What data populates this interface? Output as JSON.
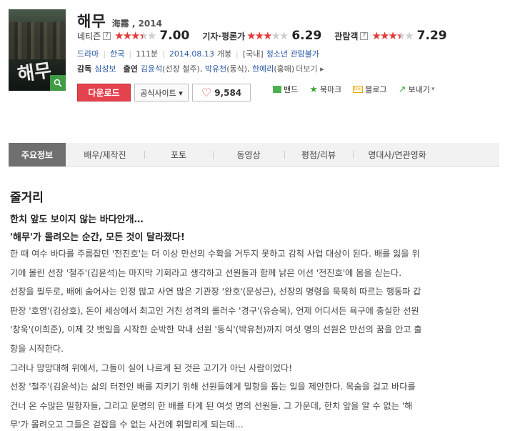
{
  "movie": {
    "title": "해무",
    "subtitle": "海霧 , 2014"
  },
  "ratings": [
    {
      "label": "네티즌",
      "has_help": true,
      "stars_filled": 3.5,
      "score": "7.00"
    },
    {
      "label": "기자·평론가",
      "has_help": false,
      "stars_filled": 3,
      "score": "6.29"
    },
    {
      "label": "관람객",
      "has_help": true,
      "stars_filled": 3.5,
      "score": "7.29"
    }
  ],
  "info": {
    "genre": "드라마",
    "country": "한국",
    "runtime": "111분",
    "release_date": "2014.08.13",
    "release_suffix": "개봉",
    "rating_region": "[국내]",
    "rating": "청소년 관람불가"
  },
  "credits": {
    "director_label": "감독",
    "director": "심성보",
    "cast_label": "출연",
    "cast": [
      {
        "name": "김윤석",
        "role": "(선장 철주)"
      },
      {
        "name": "박유천",
        "role": "(동식)"
      },
      {
        "name": "한예리",
        "role": "(홍매)"
      }
    ],
    "more": "더보기 ▸"
  },
  "actions": {
    "download": "다운로드",
    "official_site": "공식사이트 ▾",
    "like_count": "9,584"
  },
  "shares": [
    {
      "label": "밴드",
      "icon": "band-icon"
    },
    {
      "label": "북마크",
      "icon": "bookmark-star-icon"
    },
    {
      "label": "블로그",
      "icon": "blog-icon"
    },
    {
      "label": "보내기",
      "icon": "send-icon"
    }
  ],
  "tabs": [
    "주요정보",
    "배우/제작진",
    "포토",
    "동영상",
    "평점/리뷰",
    "명대사/연관영화"
  ],
  "plot": {
    "title": "줄거리",
    "headline1": "한치 앞도 보이지 않는 바다안개…",
    "headline2": "'해무'가 몰려오는 순간, 모든 것이 달라졌다!",
    "lines": [
      "한 때 여수 바다를 주름잡던 '전진호'는 더 이상 만선의 수확을 거두지 못하고 감척 사업 대상이 된다. 배를 잃을 위",
      "기에 몰린 선장 '철주'(김윤석)는 마지막 기회라고 생각하고 선원들과 함께 낡은 어선 '전진호'에 몸을 싣는다.",
      " 선장을 필두로, 배에 숨어사는 인정 많고 사연 많은 기관장 '완호'(문성근), 선장의 명령을 묵묵히 따르는 행동파 갑",
      "판장 '호영'(김상호), 돈이 세상에서 최고인 거친 성격의 롤러수 '경구'(유승목), 언제 어디서든 욕구에 충실한 선원",
      "'창욱'(이희준), 이제 갓 뱃일을 시작한 순박한 막내 선원 '동식'(박유천)까지 여섯 명의 선원은 만선의 꿈을 안고 출",
      "항을 시작한다.",
      " 그러나 망망대해 위에서, 그들이 실어 나르게 된 것은 고기가 아닌 사람이었다!",
      " 선장 '철주'(김윤석)는 삶의 터전인 배를 지키기 위해 선원들에게 밀항을 돕는 일을 제안한다. 목숨을 걸고 바다를",
      "건너 온 수많은 밀항자들, 그리고 운명의 한 배를 타게 된 여섯 명의 선원들. 그 가운데, 한치 앞을 알 수 없는 '해",
      "무'가 몰려오고 그들은 걷잡을 수 없는 사건에 휘말리게 되는데…"
    ]
  },
  "colors": {
    "accent_red": "#e4424c",
    "link_blue": "#2b5aa6",
    "star_red": "#e23a3a",
    "tab_active": "#6f6f6f"
  }
}
